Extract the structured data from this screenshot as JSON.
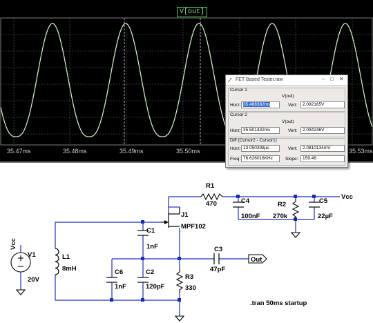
{
  "waveform": {
    "trace_label": "V[out]",
    "time_ticks": [
      "35.47ms",
      "35.48ms",
      "35.49ms",
      "35.50ms",
      "35.53ms"
    ],
    "trace_color": "#c8ecc0"
  },
  "cursor_window": {
    "title": "FET Based Tester.raw",
    "cursor1": {
      "heading": "Cursor 1",
      "trace": "V(out)",
      "horz_label": "Horz:",
      "horz_value": "35.488382ms",
      "vert_label": "Vert:",
      "vert_value": "2.092165V"
    },
    "cursor2": {
      "heading": "Cursor 2",
      "trace": "V(out)",
      "horz_label": "Horz:",
      "horz_value": "35.501432ms",
      "vert_label": "Vert:",
      "vert_value": "2.094246V"
    },
    "diff": {
      "heading": "Diff (Cursor2 - Cursor1)",
      "horz_label": "Horz:",
      "horz_value": "13.050398µs",
      "vert_label": "Vert:",
      "vert_value": "2.0810134mV",
      "freq_label": "Freq:",
      "freq_value": "76.626016KHz",
      "slope_label": "Slope:",
      "slope_value": "159.46"
    }
  },
  "schematic": {
    "R1": {
      "name": "R1",
      "value": "470"
    },
    "R2": {
      "name": "R2",
      "value": "270k"
    },
    "R3": {
      "name": "R3",
      "value": "330"
    },
    "C1": {
      "name": "C1",
      "value": "1nF"
    },
    "C2": {
      "name": "C2",
      "value": "120pF"
    },
    "C3": {
      "name": "C3",
      "value": "47pF"
    },
    "C4": {
      "name": "C4",
      "value": "100nF"
    },
    "C5": {
      "name": "C5",
      "value": "22µF"
    },
    "C6": {
      "name": "C6",
      "value": "1nF"
    },
    "L1": {
      "name": "L1",
      "value": "8mH"
    },
    "J1": {
      "name": "J1",
      "value": "MPF102"
    },
    "V1": {
      "name": "V1",
      "value": "20V"
    },
    "vcc_top": "Vcc",
    "vcc_left": "Vcc",
    "out_label": "Out",
    "directive": ".tran 50ms startup"
  }
}
